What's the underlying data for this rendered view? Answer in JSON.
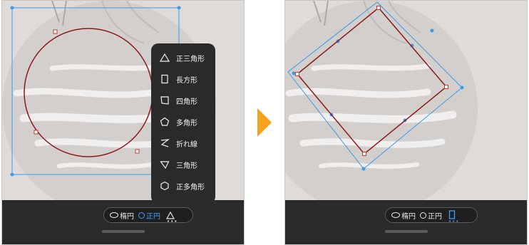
{
  "left_panel": {
    "toolbar": {
      "ellipse_label": "楕円",
      "circle_label": "正円",
      "more_label": "•••"
    },
    "shape_menu": {
      "items": [
        {
          "label": "正三角形",
          "icon": "equilateral-triangle-icon"
        },
        {
          "label": "長方形",
          "icon": "rectangle-icon"
        },
        {
          "label": "四角形",
          "icon": "quadrilateral-icon"
        },
        {
          "label": "多角形",
          "icon": "polygon-icon"
        },
        {
          "label": "折れ線",
          "icon": "polyline-icon"
        },
        {
          "label": "三角形",
          "icon": "triangle-icon"
        },
        {
          "label": "正多角形",
          "icon": "regular-polygon-icon"
        }
      ]
    }
  },
  "right_panel": {
    "toolbar": {
      "ellipse_label": "楕円",
      "circle_label": "正円",
      "more_label": "•••"
    }
  },
  "colors": {
    "accent": "#3aa0ff",
    "shape_stroke": "#8b1a1a",
    "selection": "#3d9be9",
    "arrow": "#f5a31e"
  }
}
